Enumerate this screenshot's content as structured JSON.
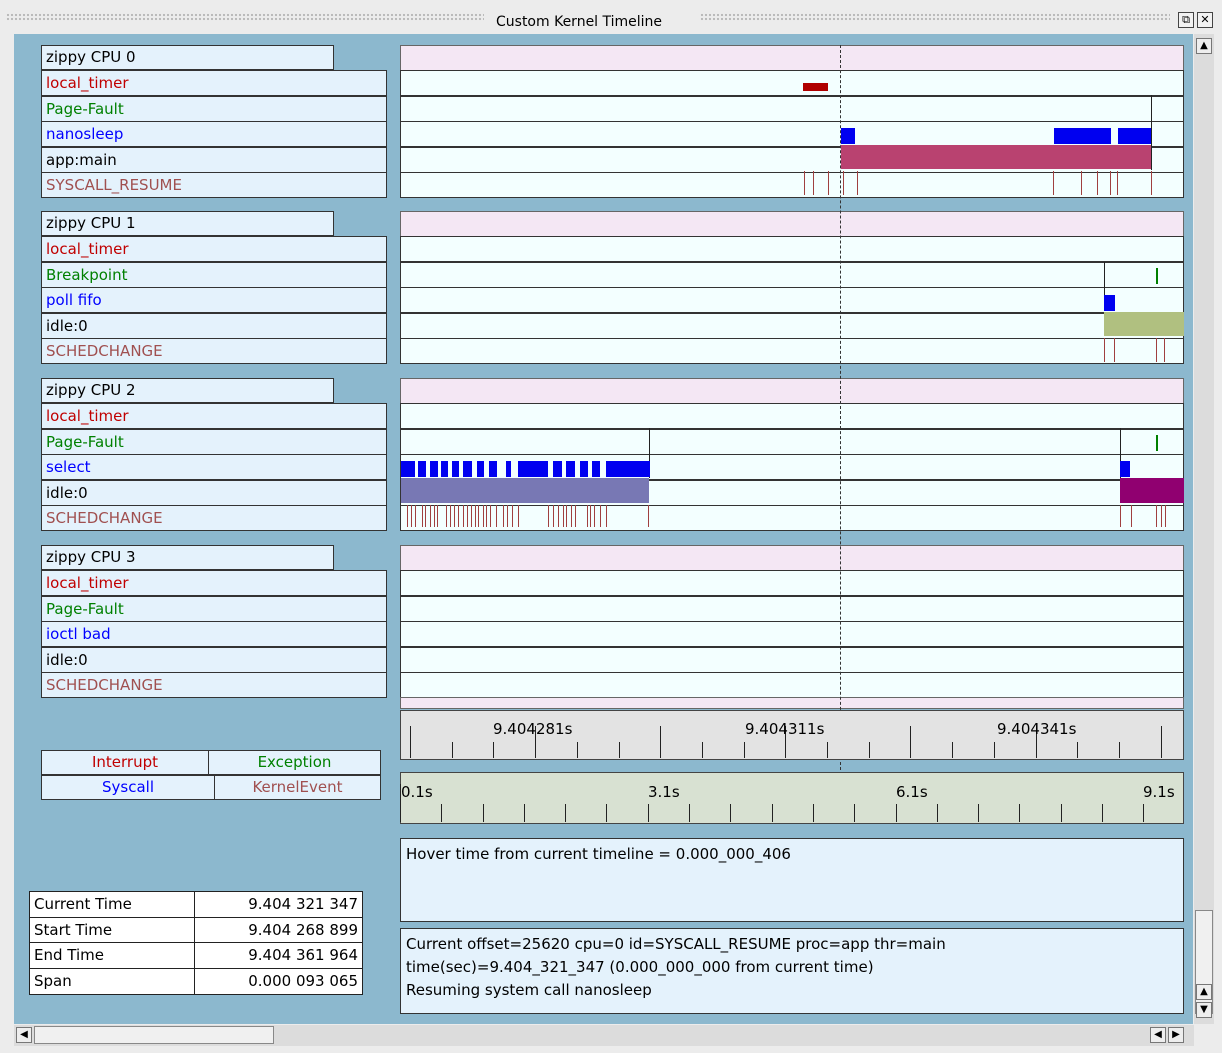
{
  "window": {
    "title": "Custom Kernel Timeline",
    "restore_glyph": "⧉",
    "close_glyph": "✕"
  },
  "cpus": [
    {
      "name": "zippy CPU 0",
      "events": [
        {
          "label": "local_timer",
          "color": "#c00000"
        },
        {
          "label": "Page-Fault",
          "color": "#008000"
        },
        {
          "label": "nanosleep",
          "color": "#0000ff"
        },
        {
          "label": "app:main",
          "color": "#000000"
        },
        {
          "label": "SYSCALL_RESUME",
          "color": "#a05050"
        }
      ]
    },
    {
      "name": "zippy CPU 1",
      "events": [
        {
          "label": "local_timer",
          "color": "#c00000"
        },
        {
          "label": "Breakpoint",
          "color": "#008000"
        },
        {
          "label": "poll fifo",
          "color": "#0000ff"
        },
        {
          "label": "idle:0",
          "color": "#000000"
        },
        {
          "label": "SCHEDCHANGE",
          "color": "#a05050"
        }
      ]
    },
    {
      "name": "zippy CPU 2",
      "events": [
        {
          "label": "local_timer",
          "color": "#c00000"
        },
        {
          "label": "Page-Fault",
          "color": "#008000"
        },
        {
          "label": "select",
          "color": "#0000ff"
        },
        {
          "label": "idle:0",
          "color": "#000000"
        },
        {
          "label": "SCHEDCHANGE",
          "color": "#a05050"
        }
      ]
    },
    {
      "name": "zippy CPU 3",
      "events": [
        {
          "label": "local_timer",
          "color": "#c00000"
        },
        {
          "label": "Page-Fault",
          "color": "#008000"
        },
        {
          "label": "ioctl bad",
          "color": "#0000ff"
        },
        {
          "label": "idle:0",
          "color": "#000000"
        },
        {
          "label": "SCHEDCHANGE",
          "color": "#a05050"
        }
      ]
    }
  ],
  "legend": {
    "interrupt": "Interrupt",
    "exception": "Exception",
    "syscall": "Syscall",
    "kernel_event": "KernelEvent",
    "colors": {
      "interrupt": "#c00000",
      "exception": "#008000",
      "syscall": "#0000ff",
      "kernel_event": "#a05050"
    }
  },
  "stats": [
    {
      "label": "Current Time",
      "value": "9.404 321 347"
    },
    {
      "label": "Start Time",
      "value": "9.404 268 899"
    },
    {
      "label": "End Time",
      "value": "9.404 361 964"
    },
    {
      "label": "Span",
      "value": "0.000 093 065"
    }
  ],
  "ruler_fine": {
    "labels": [
      "9.404281s",
      "9.404311s",
      "9.404341s"
    ]
  },
  "ruler_coarse": {
    "labels": [
      "0.1s",
      "3.1s",
      "6.1s",
      "9.1s"
    ]
  },
  "hover_text": "Hover time from current timeline = 0.000_000_406",
  "info_lines": [
    "Current offset=25620  cpu=0  id=SYSCALL_RESUME  proc=app  thr=main",
    "time(sec)=9.404_321_347   (0.000_000_000 from current time)",
    "Resuming system call nanosleep"
  ],
  "timeline_colors": {
    "interrupt": "#b00000",
    "syscall": "#0000f0",
    "exception": "#008000",
    "app_main": "#b94270",
    "idle_cpu1": "#b0c080",
    "idle_cpu2_a": "#7878b4",
    "idle_cpu2_b": "#900070",
    "kevent": "#a04040"
  }
}
